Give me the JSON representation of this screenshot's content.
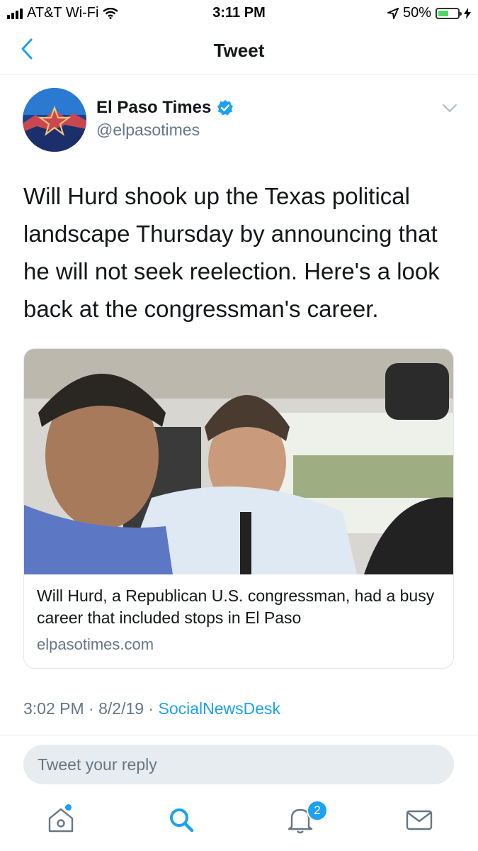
{
  "status_bar": {
    "carrier": "AT&T Wi-Fi",
    "time": "3:11 PM",
    "battery": "50%"
  },
  "nav": {
    "title": "Tweet"
  },
  "tweet": {
    "author_name": "El Paso Times",
    "author_handle": "@elpasotimes",
    "text": "Will Hurd shook up the Texas political landscape Thursday by announcing that he will not seek reelection. Here's a look back at the  congressman's career.",
    "card": {
      "headline": "Will Hurd, a Republican U.S. congressman, had a busy career that included stops in El Paso",
      "domain": "elpasotimes.com"
    },
    "timestamp": "3:02 PM · 8/2/19 · ",
    "source": "SocialNewsDesk"
  },
  "reply": {
    "placeholder": "Tweet your reply"
  },
  "tabbar": {
    "notifications_badge": "2",
    "icons": [
      "home-icon",
      "search-icon",
      "notifications-icon",
      "messages-icon"
    ]
  },
  "colors": {
    "accent": "#1da1f2",
    "muted": "#657786"
  }
}
